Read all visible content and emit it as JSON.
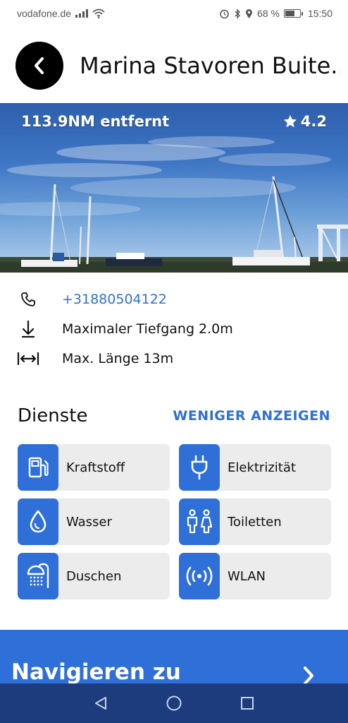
{
  "status_bar": {
    "carrier": "vodafone.de",
    "battery_percent": "68 %",
    "battery_level": 0.68,
    "time": "15:50",
    "icons": [
      "signal-icon",
      "wifi-icon",
      "alarm-icon",
      "bluetooth-icon",
      "location-icon",
      "battery-icon"
    ]
  },
  "header": {
    "title": "Marina Stavoren Buite..",
    "back_icon": "chevron-left-icon"
  },
  "hero": {
    "distance": "113.9NM entfernt",
    "rating": "4.2",
    "rating_icon": "star-icon"
  },
  "info": {
    "phone": "+31880504122",
    "draft": "Maximaler Tiefgang 2.0m",
    "length": "Max. Länge 13m"
  },
  "services": {
    "title": "Dienste",
    "toggle_label": "WENIGER ANZEIGEN",
    "items": [
      {
        "label": "Kraftstoff",
        "icon": "fuel-icon"
      },
      {
        "label": "Elektrizität",
        "icon": "plug-icon"
      },
      {
        "label": "Wasser",
        "icon": "water-drop-icon"
      },
      {
        "label": "Toiletten",
        "icon": "toilet-icon"
      },
      {
        "label": "Duschen",
        "icon": "shower-icon"
      },
      {
        "label": "WLAN",
        "icon": "wifi-signal-icon"
      }
    ]
  },
  "navigate": {
    "label": "Navigieren zu",
    "icon": "chevron-right-icon"
  },
  "colors": {
    "accent": "#2f6fd8",
    "nav_bar": "#1c3c7e",
    "tile_bg": "#ececec"
  }
}
